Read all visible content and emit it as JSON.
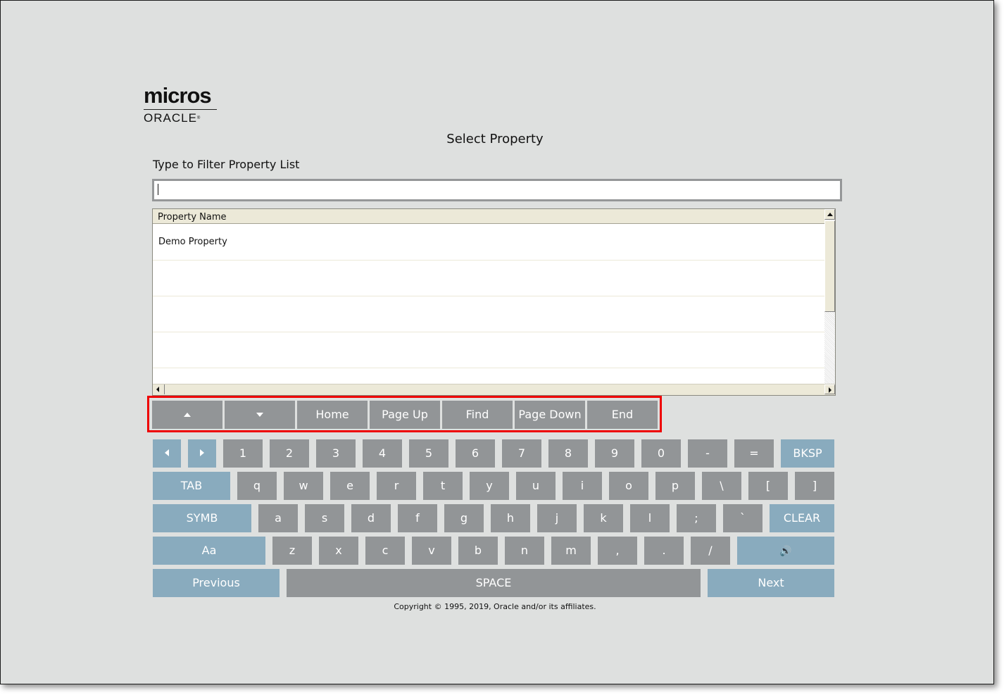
{
  "logo": {
    "brand": "micros",
    "company": "ORACLE",
    "mark": "®"
  },
  "page": {
    "title": "Select Property"
  },
  "filter": {
    "label": "Type to Filter Property List",
    "value": "",
    "placeholder": ""
  },
  "property_list": {
    "column_header": "Property Name",
    "rows": [
      "Demo Property",
      "",
      "",
      "",
      ""
    ]
  },
  "navigation": {
    "buttons": [
      {
        "name": "scroll-up-button",
        "label": "",
        "icon": "triangle-up-icon"
      },
      {
        "name": "scroll-down-button",
        "label": "",
        "icon": "triangle-down-icon"
      },
      {
        "name": "home-button",
        "label": "Home"
      },
      {
        "name": "page-up-button",
        "label": "Page Up"
      },
      {
        "name": "find-button",
        "label": "Find"
      },
      {
        "name": "page-down-button",
        "label": "Page Down"
      },
      {
        "name": "end-button",
        "label": "End"
      }
    ],
    "highlight_color": "#ee0000"
  },
  "keyboard": {
    "colors": {
      "key": "#929597",
      "function_key": "#89abbe",
      "text": "#ffffff"
    },
    "row1": [
      "1",
      "2",
      "3",
      "4",
      "5",
      "6",
      "7",
      "8",
      "9",
      "0",
      "-",
      "="
    ],
    "row2": [
      "q",
      "w",
      "e",
      "r",
      "t",
      "y",
      "u",
      "i",
      "o",
      "p",
      "\\",
      "[",
      "]"
    ],
    "row3": [
      "a",
      "s",
      "d",
      "f",
      "g",
      "h",
      "j",
      "k",
      "l",
      ";",
      "`"
    ],
    "row4": [
      "z",
      "x",
      "c",
      "v",
      "b",
      "n",
      "m",
      ",",
      ".",
      "/"
    ],
    "special": {
      "cursor_left": "",
      "cursor_right": "",
      "backspace": "BKSP",
      "tab": "TAB",
      "symbols": "SYMB",
      "clear": "CLEAR",
      "case_toggle": "Aa",
      "sound": "🔊",
      "previous": "Previous",
      "space": "SPACE",
      "next": "Next"
    }
  },
  "footer": {
    "copyright": "Copyright © 1995, 2019, Oracle and/or its affiliates."
  }
}
